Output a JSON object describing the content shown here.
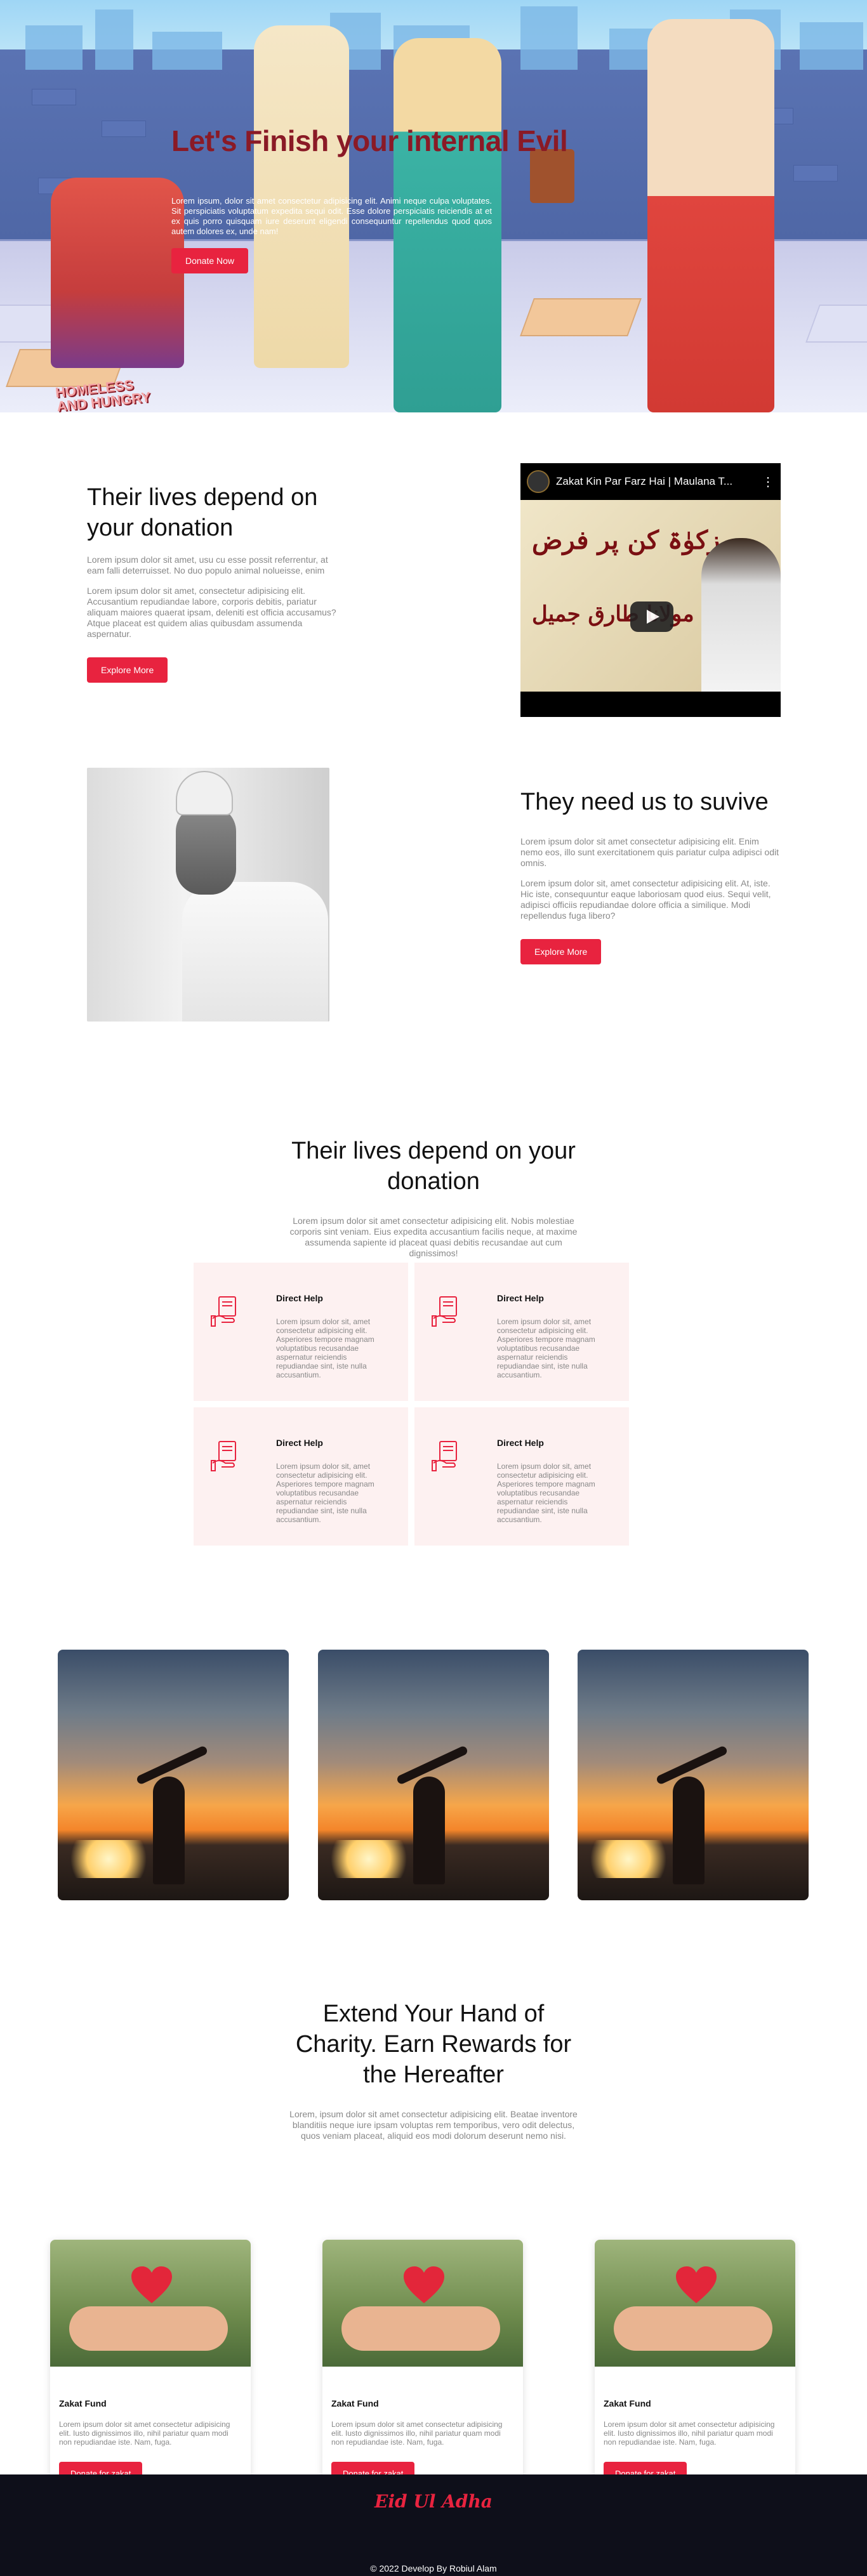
{
  "hero": {
    "title": "Let's Finish your internal Evil",
    "text": "Lorem ipsum, dolor sit amet consectetur adipisicing elit. Animi neque culpa voluptates. Sit perspiciatis voluptatum expedita sequi odit. Esse dolore perspiciatis reiciendis at et ex quis porro quisquam iure deserunt eligendi consequuntur repellendus quod quos autem dolores ex, unde nam!",
    "button": "Donate Now",
    "illustration_text": "HOMELESS AND HUNGRY"
  },
  "section1": {
    "title": "Their lives depend on your donation",
    "para1": "Lorem ipsum dolor sit amet, usu cu esse possit referrentur, at eam falli deterruisset. No duo populo animal nolueisse, enim",
    "para2": "Lorem ipsum dolor sit amet, consectetur adipisicing elit. Accusantium repudiandae labore, corporis debitis, pariatur aliquam maiores quaerat ipsam, deleniti est officia accusamus? Atque placeat est quidem alias quibusdam assumenda aspernatur.",
    "button": "Explore More",
    "video_title": "Zakat Kin Par Farz Hai | Maulana T..."
  },
  "section2": {
    "title": "They need us to suvive",
    "para1": "Lorem ipsum dolor sit amet consectetur adipisicing elit. Enim nemo eos, illo sunt exercitationem quis pariatur culpa adipisci odit omnis.",
    "para2": "Lorem ipsum dolor sit, amet consectetur adipisicing elit. At, iste. Hic iste, consequuntur eaque laboriosam quod eius. Sequi velit, adipisci officiis repudiandae dolore officia a similique. Modi repellendus fuga libero?",
    "button": "Explore More"
  },
  "section3": {
    "title": "Their lives depend on your donation",
    "para": "Lorem ipsum dolor sit amet consectetur adipisicing elit. Nobis molestiae corporis sint veniam. Eius expedita accusantium facilis neque, at maxime assumenda sapiente id placeat quasi debitis recusandae aut cum dignissimos!",
    "cards": [
      {
        "title": "Direct Help",
        "desc": "Lorem ipsum dolor sit, amet consectetur adipisicing elit. Asperiores tempore magnam voluptatibus recusandae aspernatur reiciendis repudiandae sint, iste nulla accusantium."
      },
      {
        "title": "Direct Help",
        "desc": "Lorem ipsum dolor sit, amet consectetur adipisicing elit. Asperiores tempore magnam voluptatibus recusandae aspernatur reiciendis repudiandae sint, iste nulla accusantium."
      },
      {
        "title": "Direct Help",
        "desc": "Lorem ipsum dolor sit, amet consectetur adipisicing elit. Asperiores tempore magnam voluptatibus recusandae aspernatur reiciendis repudiandae sint, iste nulla accusantium."
      },
      {
        "title": "Direct Help",
        "desc": "Lorem ipsum dolor sit, amet consectetur adipisicing elit. Asperiores tempore magnam voluptatibus recusandae aspernatur reiciendis repudiandae sint, iste nulla accusantium."
      }
    ]
  },
  "section5": {
    "title": "Extend Your Hand of Charity. Earn Rewards for the Hereafter",
    "para": "Lorem, ipsum dolor sit amet consectetur adipisicing elit. Beatae inventore blanditiis neque iure ipsam voluptas rem temporibus, vero odit delectus, quos veniam placeat, aliquid eos modi dolorum deserunt nemo nisi.",
    "funds": [
      {
        "title": "Zakat Fund",
        "desc": "Lorem ipsum dolor sit amet consectetur adipisicing elit. Iusto dignissimos illo, nihil pariatur quam modi non repudiandae iste. Nam, fuga.",
        "button": "Donate for zakat"
      },
      {
        "title": "Zakat Fund",
        "desc": "Lorem ipsum dolor sit amet consectetur adipisicing elit. Iusto dignissimos illo, nihil pariatur quam modi non repudiandae iste. Nam, fuga.",
        "button": "Donate for zakat"
      },
      {
        "title": "Zakat Fund",
        "desc": "Lorem ipsum dolor sit amet consectetur adipisicing elit. Iusto dignissimos illo, nihil pariatur quam modi non repudiandae iste. Nam, fuga.",
        "button": "Donate for zakat"
      }
    ]
  },
  "footer": {
    "logo": "Eid Ul Adha",
    "copyright": "© 2022 Develop By Robiul Alam"
  },
  "colors": {
    "accent": "#e8233f",
    "card_bg": "#fdf1f1",
    "footer_bg": "#0e0f1a",
    "hero_title": "#8a1a26"
  }
}
